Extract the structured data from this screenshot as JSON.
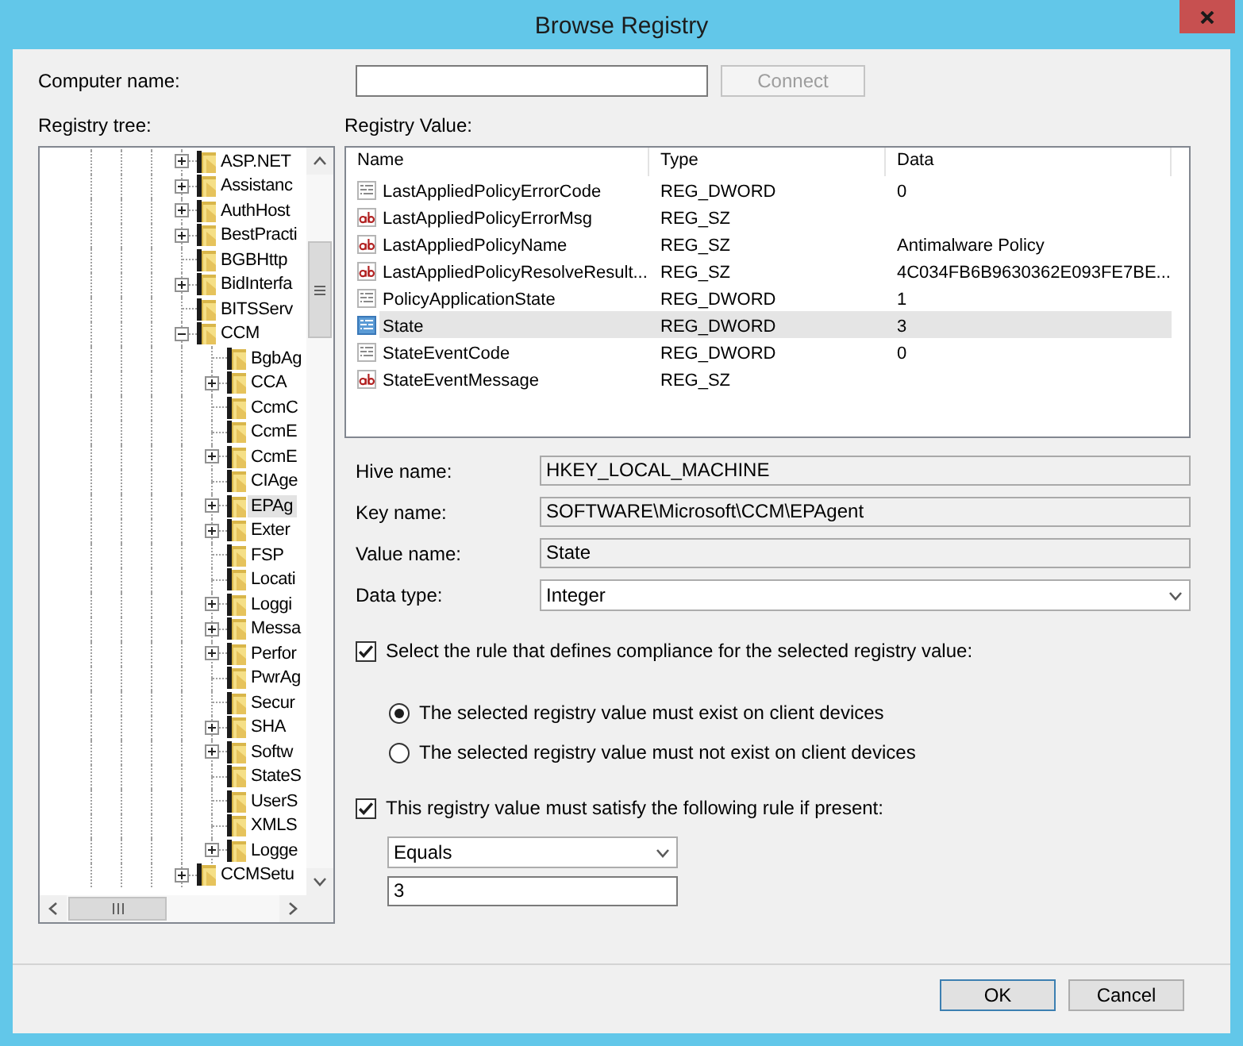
{
  "window": {
    "title": "Browse Registry"
  },
  "computer_name": {
    "label": "Computer name:"
  },
  "connect_button": {
    "label": "Connect",
    "disabled": true
  },
  "tree": {
    "label": "Registry tree:",
    "items": [
      {
        "label": "ASP.NET",
        "kind": "branch",
        "expanded": false,
        "selected": false
      },
      {
        "label": "Assistanc",
        "kind": "branch",
        "expanded": false,
        "selected": false
      },
      {
        "label": "AuthHost",
        "kind": "branch",
        "expanded": false,
        "selected": false
      },
      {
        "label": "BestPracti",
        "kind": "branch",
        "expanded": false,
        "selected": false
      },
      {
        "label": "BGBHttp",
        "kind": "leaf",
        "selected": false
      },
      {
        "label": "BidInterfa",
        "kind": "branch",
        "expanded": false,
        "selected": false
      },
      {
        "label": "BITSServ",
        "kind": "leaf",
        "selected": false
      },
      {
        "label": "CCM",
        "kind": "branch",
        "expanded": true,
        "selected": false,
        "children": [
          {
            "label": "BgbAg",
            "kind": "leaf",
            "selected": false
          },
          {
            "label": "CCA",
            "kind": "branch",
            "expanded": false,
            "selected": false
          },
          {
            "label": "CcmC",
            "kind": "leaf",
            "selected": false
          },
          {
            "label": "CcmE",
            "kind": "leaf",
            "selected": false
          },
          {
            "label": "CcmE",
            "kind": "branch",
            "expanded": false,
            "selected": false
          },
          {
            "label": "CIAge",
            "kind": "leaf",
            "selected": false
          },
          {
            "label": "EPAg",
            "kind": "branch",
            "expanded": false,
            "selected": true
          },
          {
            "label": "Exter",
            "kind": "branch",
            "expanded": false,
            "selected": false
          },
          {
            "label": "FSP",
            "kind": "leaf",
            "selected": false
          },
          {
            "label": "Locati",
            "kind": "leaf",
            "selected": false
          },
          {
            "label": "Loggi",
            "kind": "branch",
            "expanded": false,
            "selected": false
          },
          {
            "label": "Messa",
            "kind": "branch",
            "expanded": false,
            "selected": false
          },
          {
            "label": "Perfor",
            "kind": "branch",
            "expanded": false,
            "selected": false
          },
          {
            "label": "PwrAg",
            "kind": "leaf",
            "selected": false
          },
          {
            "label": "Secur",
            "kind": "leaf",
            "selected": false
          },
          {
            "label": "SHA",
            "kind": "branch",
            "expanded": false,
            "selected": false
          },
          {
            "label": "Softw",
            "kind": "branch",
            "expanded": false,
            "selected": false
          },
          {
            "label": "StateS",
            "kind": "leaf",
            "selected": false
          },
          {
            "label": "UserS",
            "kind": "leaf",
            "selected": false
          },
          {
            "label": "XMLS",
            "kind": "leaf",
            "selected": false
          },
          {
            "label": "Logge",
            "kind": "branch",
            "expanded": false,
            "selected": false
          }
        ]
      },
      {
        "label": "CCMSetu",
        "kind": "branch",
        "expanded": false,
        "selected": false
      }
    ]
  },
  "registry_values": {
    "label": "Registry Value:",
    "columns": [
      "Name",
      "Type",
      "Data"
    ],
    "rows": [
      {
        "kind": "dword",
        "name": "LastAppliedPolicyErrorCode",
        "type": "REG_DWORD",
        "data": "0",
        "selected": false
      },
      {
        "kind": "sz",
        "name": "LastAppliedPolicyErrorMsg",
        "type": "REG_SZ",
        "selected": false
      },
      {
        "kind": "sz",
        "name": "LastAppliedPolicyName",
        "type": "REG_SZ",
        "data": "Antimalware Policy",
        "selected": false
      },
      {
        "kind": "sz",
        "name": "LastAppliedPolicyResolveResult...",
        "type": "REG_SZ",
        "data": "4C034FB6B9630362E093FE7BE...",
        "selected": false
      },
      {
        "kind": "dword",
        "name": "PolicyApplicationState",
        "type": "REG_DWORD",
        "data": "1",
        "selected": false
      },
      {
        "kind": "dword",
        "name": "State",
        "type": "REG_DWORD",
        "data": "3",
        "selected": true
      },
      {
        "kind": "dword",
        "name": "StateEventCode",
        "type": "REG_DWORD",
        "data": "0",
        "selected": false
      },
      {
        "kind": "sz",
        "name": "StateEventMessage",
        "type": "REG_SZ",
        "selected": false
      }
    ]
  },
  "details": [
    {
      "kind": "readonly",
      "label": "Hive name:",
      "value": "HKEY_LOCAL_MACHINE"
    },
    {
      "kind": "readonly",
      "label": "Key name:",
      "value": "SOFTWARE\\Microsoft\\CCM\\EPAgent"
    },
    {
      "kind": "readonly",
      "label": "Value name:",
      "value": "State"
    },
    {
      "kind": "dropdown",
      "label": "Data type:",
      "value": "Integer"
    }
  ],
  "compliance_rule": {
    "checked": true,
    "label": "Select the rule that defines compliance for the selected registry value:",
    "options": [
      {
        "label": "The selected registry value must exist on client devices",
        "selected": true
      },
      {
        "label": "The selected registry value must not exist on client devices",
        "selected": false
      }
    ]
  },
  "value_rule": {
    "checked": true,
    "label": "This registry value must satisfy the following rule if present:",
    "operator": "Equals",
    "value": "3"
  },
  "buttons": [
    {
      "label": "OK",
      "default": true
    },
    {
      "label": "Cancel",
      "default": false
    }
  ]
}
